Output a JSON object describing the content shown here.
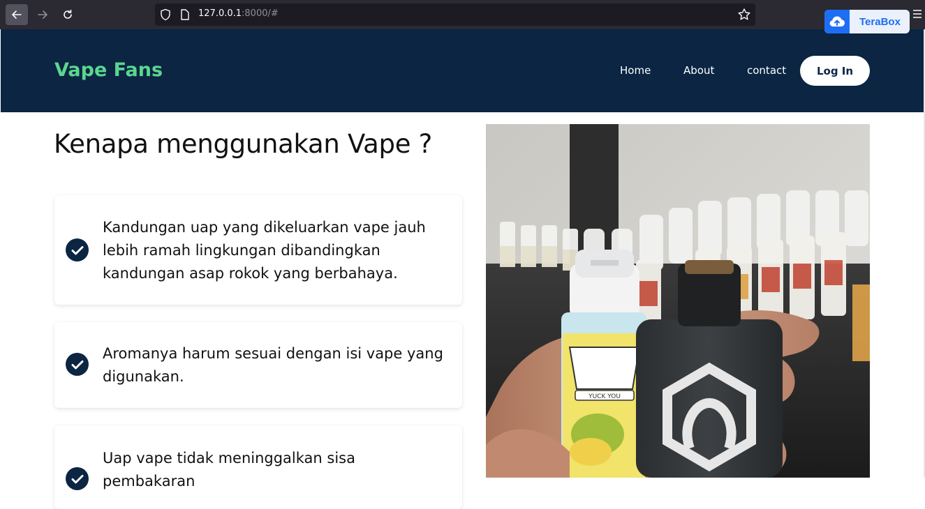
{
  "browser": {
    "url_host": "127.0.0.1",
    "url_rest": ":8000/#",
    "extension_label": "TeraBox"
  },
  "site": {
    "brand": "Vape Fans",
    "nav": {
      "home": "Home",
      "about": "About",
      "contact": "contact",
      "login": "Log In"
    }
  },
  "main": {
    "headline": "Kenapa menggunakan Vape ?",
    "benefits": [
      "Kandungan uap yang dikeluarkan vape jauh lebih ramah lingkungan dibandingkan kandungan asap rokok yang berbahaya.",
      "Aromanya harum sesuai dengan isi vape yang digunakan.",
      "Uap vape tidak meninggalkan sisa pembakaran"
    ],
    "photo": {
      "label_text": "YUCK YOU"
    }
  },
  "colors": {
    "header_bg": "#0b2543",
    "brand_green": "#5bd68f",
    "check_bg": "#0b2543"
  }
}
